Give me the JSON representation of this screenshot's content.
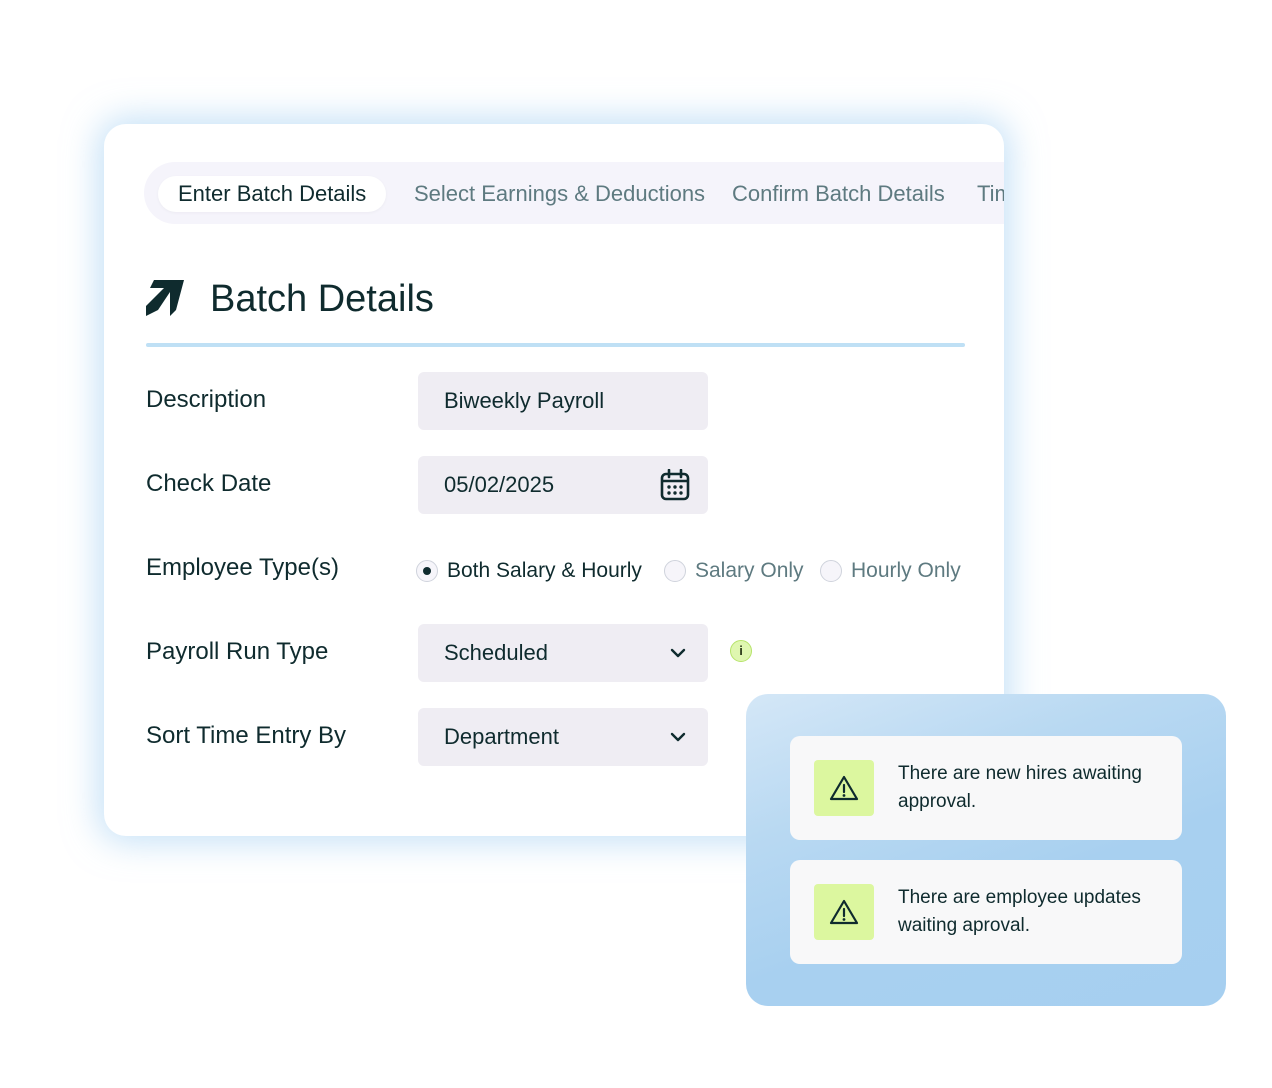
{
  "tabs": [
    {
      "label": "Enter Batch  Details",
      "active": true
    },
    {
      "label": "Select Earnings & Deductions",
      "active": false
    },
    {
      "label": "Confirm Batch  Details",
      "active": false
    },
    {
      "label": "Tim",
      "active": false
    }
  ],
  "page_title": "Batch Details",
  "form": {
    "description": {
      "label": "Description",
      "value": "Biweekly Payroll"
    },
    "check_date": {
      "label": "Check Date",
      "value": "05/02/2025",
      "icon": "calendar-icon"
    },
    "employee_types": {
      "label": "Employee Type(s)",
      "options": [
        "Both Salary & Hourly",
        "Salary Only",
        "Hourly Only"
      ],
      "selected": "Both Salary & Hourly"
    },
    "payroll_run_type": {
      "label": "Payroll Run Type",
      "value": "Scheduled",
      "info_icon": "i"
    },
    "sort_time_entry": {
      "label": "Sort Time Entry By",
      "value": "Department"
    }
  },
  "notifications": [
    {
      "message": "There are new hires awaiting approval.",
      "icon": "warning-icon"
    },
    {
      "message": "There are employee updates waiting aproval.",
      "icon": "warning-icon"
    }
  ],
  "colors": {
    "text": "#0f2b2e",
    "muted": "#5e7a80",
    "field_bg": "#efedf3",
    "divider": "#bfe0f5",
    "warning_bg": "#dcf79f",
    "panel_bg": "#a8d0f0"
  }
}
